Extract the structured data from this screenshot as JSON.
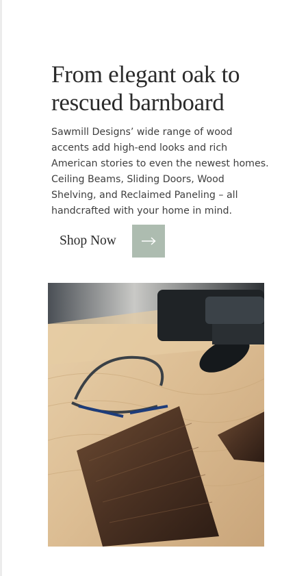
{
  "hero": {
    "headline": "From elegant oak to rescued barnboard",
    "body": "Sawmill Designs’ wide range of wood accents add high-end looks and rich American stories to even the newest homes. Ceiling Beams, Sliding Doors, Wood Shelving, and Reclaimed Paneling – all handcrafted with your home in mind.",
    "cta_label": "Shop Now",
    "cta_icon": "arrow-right-icon"
  },
  "colors": {
    "cta_button_bg": "#adbcb0",
    "heading_text": "#2a2a2a",
    "body_text": "#3e3e3e"
  },
  "image": {
    "subject": "workshop-photo"
  }
}
